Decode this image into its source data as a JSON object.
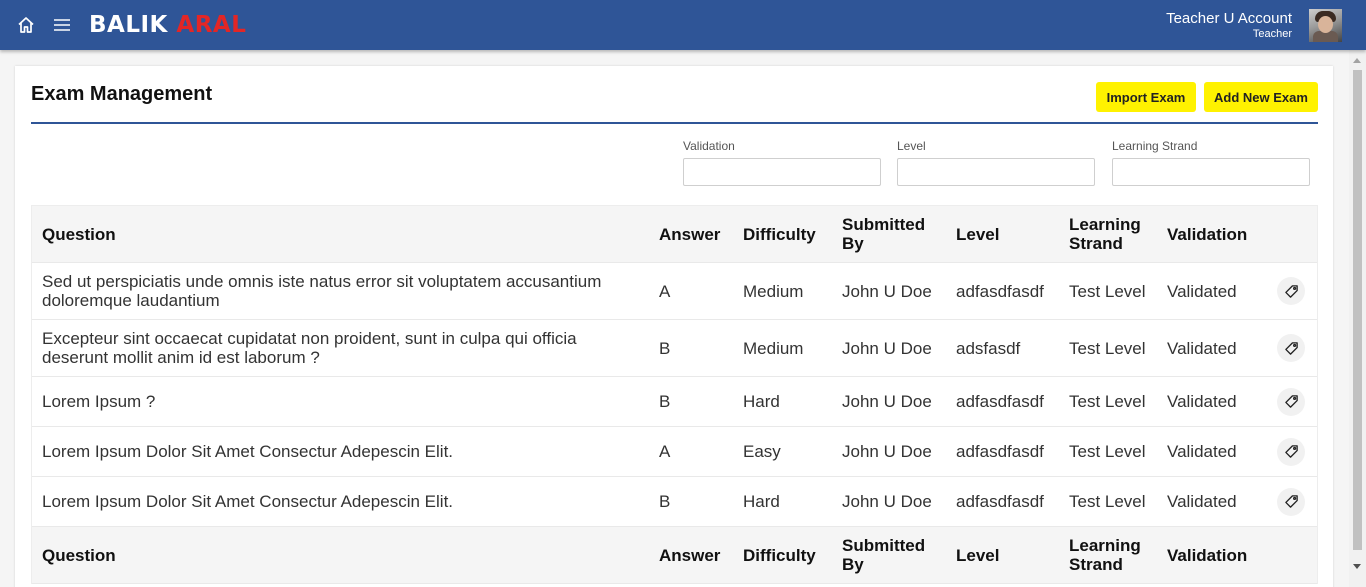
{
  "header": {
    "brand_part1": "BALIK",
    "brand_part2": "ARAL",
    "account_name": "Teacher U Account",
    "account_role": "Teacher",
    "colors": {
      "bar": "#2f5597",
      "brand_accent": "#e32626",
      "button": "#fff200"
    }
  },
  "page": {
    "title": "Exam Management",
    "import_label": "Import Exam",
    "add_label": "Add New Exam"
  },
  "filters": {
    "validation_label": "Validation",
    "validation_value": "",
    "level_label": "Level",
    "level_value": "",
    "strand_label": "Learning Strand",
    "strand_value": ""
  },
  "table": {
    "columns": {
      "question": "Question",
      "answer": "Answer",
      "difficulty": "Difficulty",
      "submitted_by": "Submitted By",
      "level": "Level",
      "learning_strand": "Learning Strand",
      "validation": "Validation"
    },
    "rows": [
      {
        "question": "Sed ut perspiciatis unde omnis iste natus error sit voluptatem accusantium doloremque laudantium",
        "answer": "A",
        "difficulty": "Medium",
        "submitted_by": "John U Doe",
        "level": "adfasdfasdf",
        "learning_strand": "Test Level",
        "validation": "Validated",
        "action_icon": "tag-icon"
      },
      {
        "question": "Excepteur sint occaecat cupidatat non proident, sunt in culpa qui officia deserunt mollit anim id est laborum ?",
        "answer": "B",
        "difficulty": "Medium",
        "submitted_by": "John U Doe",
        "level": "adsfasdf",
        "learning_strand": "Test Level",
        "validation": "Validated",
        "action_icon": "tag-icon"
      },
      {
        "question": "Lorem Ipsum ?",
        "answer": "B",
        "difficulty": "Hard",
        "submitted_by": "John U Doe",
        "level": "adfasdfasdf",
        "learning_strand": "Test Level",
        "validation": "Validated",
        "action_icon": "tag-icon"
      },
      {
        "question": "Lorem Ipsum Dolor Sit Amet Consectur Adepescin Elit.",
        "answer": "A",
        "difficulty": "Easy",
        "submitted_by": "John U Doe",
        "level": "adfasdfasdf",
        "learning_strand": "Test Level",
        "validation": "Validated",
        "action_icon": "tag-icon"
      },
      {
        "question": "Lorem Ipsum Dolor Sit Amet Consectur Adepescin Elit.",
        "answer": "B",
        "difficulty": "Hard",
        "submitted_by": "John U Doe",
        "level": "adfasdfasdf",
        "learning_strand": "Test Level",
        "validation": "Validated",
        "action_icon": "tag-icon"
      }
    ]
  }
}
